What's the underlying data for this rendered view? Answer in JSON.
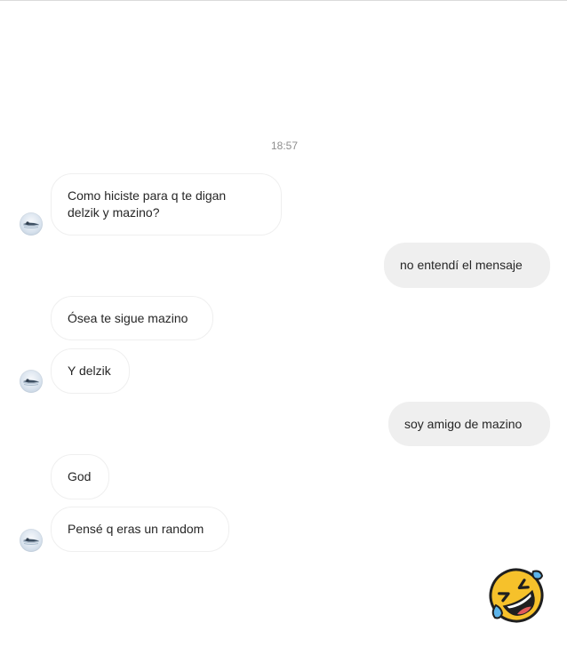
{
  "thread": {
    "timestamp": "18:57",
    "messages": [
      {
        "sender": "other",
        "text_lines": [
          "Como hiciste para q te digan",
          "delzik y mazino?"
        ]
      },
      {
        "sender": "me",
        "text": "no entendí el mensaje"
      },
      {
        "sender": "other",
        "text": "Ósea te sigue mazino"
      },
      {
        "sender": "other",
        "text": "Y delzik"
      },
      {
        "sender": "me",
        "text": "soy amigo de mazino"
      },
      {
        "sender": "other",
        "text": "God"
      },
      {
        "sender": "other",
        "text": "Pensé q eras un random"
      },
      {
        "sender": "me",
        "emoji": "rolling-on-the-floor-laughing"
      }
    ]
  },
  "avatar": {
    "icon": "profile-avatar"
  },
  "colors": {
    "incoming_bubble_bg": "#ffffff",
    "incoming_bubble_border": "#efefef",
    "outgoing_bubble_bg": "#efefef",
    "text": "#262626",
    "timestamp": "#8e8e8e",
    "emoji_face": "#f6c12b",
    "emoji_tears": "#5db4ea"
  }
}
